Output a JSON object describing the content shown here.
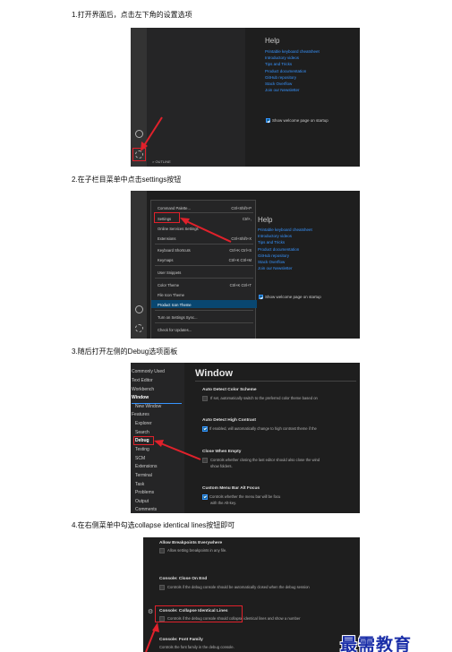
{
  "steps": [
    "1.打开界面后，点击左下角的设置选项",
    "2.在子栏目菜单中点击settings按钮",
    "3.随后打开左侧的Debug选项面板",
    "4.在右侧菜单中勾选collapse identical lines按钮即可"
  ],
  "welcome": {
    "help_title": "Help",
    "links": [
      "Printable keyboard cheatsheet",
      "Introductory videos",
      "Tips and Tricks",
      "Product documentation",
      "GitHub repository",
      "Stack Overflow",
      "Join our Newsletter"
    ],
    "startup_checkbox": "Show welcome page on startup",
    "outline_label": "> OUTLINE"
  },
  "menu": {
    "items": [
      {
        "label": "Command Palette...",
        "key": "Ctrl+Shift+P"
      },
      {
        "label": "Settings",
        "key": "Ctrl+,"
      },
      {
        "label": "Online Services Settings",
        "key": ""
      },
      {
        "label": "Extensions",
        "key": "Ctrl+Shift+X"
      },
      {
        "label": "Keyboard Shortcuts",
        "key": "Ctrl+K Ctrl+S"
      },
      {
        "label": "Keymaps",
        "key": "Ctrl+K Ctrl+M"
      },
      {
        "label": "User Snippets",
        "key": ""
      },
      {
        "label": "Color Theme",
        "key": "Ctrl+K Ctrl+T"
      },
      {
        "label": "File Icon Theme",
        "key": ""
      },
      {
        "label": "Product Icon Theme",
        "key": ""
      },
      {
        "label": "Turn on Settings Sync...",
        "key": ""
      },
      {
        "label": "Check for Updates...",
        "key": ""
      }
    ]
  },
  "settings_window": {
    "tree": [
      "Commonly Used",
      "Text Editor",
      "Workbench",
      "Window",
      "New Window",
      "Features",
      "Explorer",
      "Search",
      "Debug",
      "Testing",
      "SCM",
      "Extensions",
      "Terminal",
      "Task",
      "Problems",
      "Output",
      "Comments"
    ],
    "heading": "Window",
    "items": [
      {
        "title": "Auto Detect Color Scheme",
        "desc": "If set, automatically switch to the preferred color theme based on"
      },
      {
        "title": "Auto Detect High Contrast",
        "desc": "If enabled, will automatically change to high contrast theme if the"
      },
      {
        "title": "Close When Empty",
        "desc": "Controls whether closing the last editor should also close the wind",
        "desc2": "show folders."
      },
      {
        "title": "Custom Menu Bar Alt Focus",
        "desc": "Controls whether the menu bar will be focu",
        "desc2": "with the Alt-key."
      }
    ]
  },
  "debug_settings": {
    "items": [
      {
        "title": "Allow Breakpoints Everywhere",
        "desc": "Allow setting breakpoints in any file."
      },
      {
        "title": "Console: Close On End",
        "desc": "Controls if the debug console should be automatically closed when the debug session"
      },
      {
        "title": "Console: Collapse Identical Lines",
        "desc": "Controls if the debug console should collapse identical lines and show a number"
      },
      {
        "title": "Console: Font Family",
        "desc": "Controls the font family in the debug console."
      }
    ]
  },
  "watermark": "最需教育"
}
